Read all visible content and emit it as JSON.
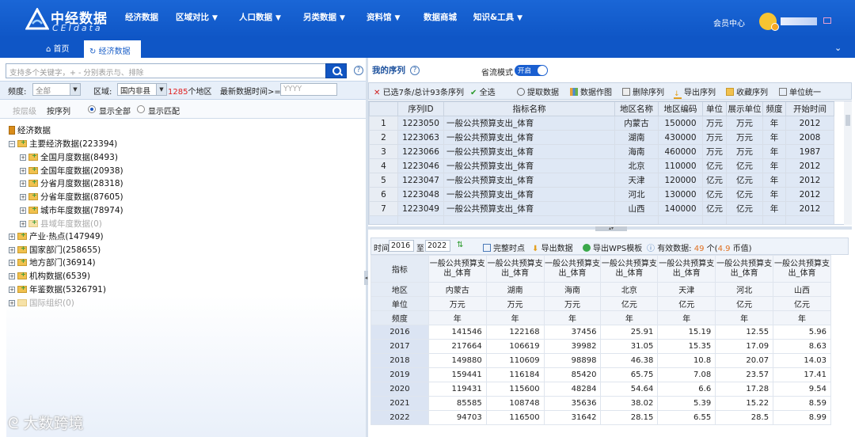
{
  "header": {
    "logo_cn": "中经数据",
    "logo_en": "CEIdata",
    "nav": [
      {
        "label": "经济数据",
        "dropdown": false
      },
      {
        "label": "区域对比",
        "dropdown": true
      },
      {
        "label": "人口数据",
        "dropdown": true
      },
      {
        "label": "另类数据",
        "dropdown": true
      },
      {
        "label": "资料馆",
        "dropdown": true
      },
      {
        "label": "数据商城",
        "dropdown": false
      },
      {
        "label": "知识&工具",
        "dropdown": true
      }
    ],
    "member": "会员中心"
  },
  "tabs": {
    "home": "首页",
    "economic": "经济数据"
  },
  "search": {
    "placeholder": "支持多个关键字，+ - 分别表示与、排除"
  },
  "filters": {
    "freq_label": "频度:",
    "freq_value": "全部",
    "region_label": "区域:",
    "region_value": "国内非县",
    "region_count": "1285",
    "region_suffix": "个地区",
    "latest_label": "最新数据时间>=",
    "latest_placeholder": "YYYY"
  },
  "options": {
    "by_level": "按层级",
    "by_sequence": "按序列",
    "show_all": "显示全部",
    "show_match": "显示匹配"
  },
  "tree": {
    "root": "经济数据",
    "items": [
      {
        "label": "主要经济数据(223394)",
        "dim": false
      },
      {
        "label": "全国月度数据(8493)",
        "dim": false
      },
      {
        "label": "全国年度数据(20938)",
        "dim": false
      },
      {
        "label": "分省月度数据(28318)",
        "dim": false
      },
      {
        "label": "分省年度数据(87605)",
        "dim": false
      },
      {
        "label": "城市年度数据(78974)",
        "dim": false
      },
      {
        "label": "县域年度数据(0)",
        "dim": true
      },
      {
        "label": "产业·热点(147949)",
        "dim": false
      },
      {
        "label": "国家部门(258655)",
        "dim": false
      },
      {
        "label": "地方部门(36914)",
        "dim": false
      },
      {
        "label": "机构数据(6539)",
        "dim": false
      },
      {
        "label": "年鉴数据(5326791)",
        "dim": false
      },
      {
        "label": "国际组织(0)",
        "dim": true
      }
    ]
  },
  "watermark": "大数跨境",
  "my_series": {
    "title": "我的序列",
    "mode_label": "省流模式",
    "mode_value": "开启",
    "toolbar": {
      "selected": "已选7条/总计93条序列",
      "select_all": "全选",
      "extract": "提取数据",
      "chart": "数据作图",
      "delete": "删除序列",
      "export": "导出序列",
      "favorite": "收藏序列",
      "unify": "单位统一"
    },
    "columns": [
      "序列ID",
      "指标名称",
      "地区名称",
      "地区编码",
      "单位",
      "展示单位",
      "频度",
      "开始时间"
    ],
    "rows": [
      {
        "n": "1",
        "id": "1223050",
        "name": "一般公共预算支出_体育",
        "region": "内蒙古",
        "code": "150000",
        "unit": "万元",
        "dunit": "万元",
        "freq": "年",
        "start": "2012"
      },
      {
        "n": "2",
        "id": "1223063",
        "name": "一般公共预算支出_体育",
        "region": "湖南",
        "code": "430000",
        "unit": "万元",
        "dunit": "万元",
        "freq": "年",
        "start": "2008"
      },
      {
        "n": "3",
        "id": "1223066",
        "name": "一般公共预算支出_体育",
        "region": "海南",
        "code": "460000",
        "unit": "万元",
        "dunit": "万元",
        "freq": "年",
        "start": "1987"
      },
      {
        "n": "4",
        "id": "1223046",
        "name": "一般公共预算支出_体育",
        "region": "北京",
        "code": "110000",
        "unit": "亿元",
        "dunit": "亿元",
        "freq": "年",
        "start": "2012"
      },
      {
        "n": "5",
        "id": "1223047",
        "name": "一般公共预算支出_体育",
        "region": "天津",
        "code": "120000",
        "unit": "亿元",
        "dunit": "亿元",
        "freq": "年",
        "start": "2012"
      },
      {
        "n": "6",
        "id": "1223048",
        "name": "一般公共预算支出_体育",
        "region": "河北",
        "code": "130000",
        "unit": "亿元",
        "dunit": "亿元",
        "freq": "年",
        "start": "2012"
      },
      {
        "n": "7",
        "id": "1223049",
        "name": "一般公共预算支出_体育",
        "region": "山西",
        "code": "140000",
        "unit": "亿元",
        "dunit": "亿元",
        "freq": "年",
        "start": "2012"
      }
    ]
  },
  "data_toolbar": {
    "time_label": "时间",
    "from": "2016",
    "to_label": "至",
    "to": "2022",
    "full_period": "完整时点",
    "export": "导出数据",
    "export_wps": "导出WPS模板",
    "valid_label": "有效数据:",
    "valid_count": "49",
    "valid_unit": "个",
    "coin_pre": "(",
    "coin": "4.9",
    "coin_unit": "币值)"
  },
  "data_table": {
    "row_headers": [
      "指标",
      "地区",
      "单位",
      "频度"
    ],
    "series": [
      {
        "name": "一般公共预算支出_体育",
        "region": "内蒙古",
        "unit": "万元",
        "freq": "年"
      },
      {
        "name": "一般公共预算支出_体育",
        "region": "湖南",
        "unit": "万元",
        "freq": "年"
      },
      {
        "name": "一般公共预算支出_体育",
        "region": "海南",
        "unit": "万元",
        "freq": "年"
      },
      {
        "name": "一般公共预算支出_体育",
        "region": "北京",
        "unit": "亿元",
        "freq": "年"
      },
      {
        "name": "一般公共预算支出_体育",
        "region": "天津",
        "unit": "亿元",
        "freq": "年"
      },
      {
        "name": "一般公共预算支出_体育",
        "region": "河北",
        "unit": "亿元",
        "freq": "年"
      },
      {
        "name": "一般公共预算支出_体育",
        "region": "山西",
        "unit": "亿元",
        "freq": "年"
      }
    ],
    "years": [
      "2016",
      "2017",
      "2018",
      "2019",
      "2020",
      "2021",
      "2022"
    ],
    "values": [
      [
        "141546",
        "122168",
        "37456",
        "25.91",
        "15.19",
        "12.55",
        "5.96"
      ],
      [
        "217664",
        "106619",
        "39982",
        "31.05",
        "15.35",
        "17.09",
        "8.63"
      ],
      [
        "149880",
        "110609",
        "98898",
        "46.38",
        "10.8",
        "20.07",
        "14.03"
      ],
      [
        "159441",
        "116184",
        "85420",
        "65.75",
        "7.08",
        "23.57",
        "17.41"
      ],
      [
        "119431",
        "115600",
        "48284",
        "54.64",
        "6.6",
        "17.28",
        "9.54"
      ],
      [
        "85585",
        "108748",
        "35636",
        "38.02",
        "5.39",
        "15.22",
        "8.59"
      ],
      [
        "94703",
        "116500",
        "31642",
        "28.15",
        "6.55",
        "28.5",
        "8.99"
      ]
    ]
  },
  "colors": {
    "brand": "#1560d2",
    "accent_red": "#e02020",
    "toggle": "#1a5fd0"
  }
}
